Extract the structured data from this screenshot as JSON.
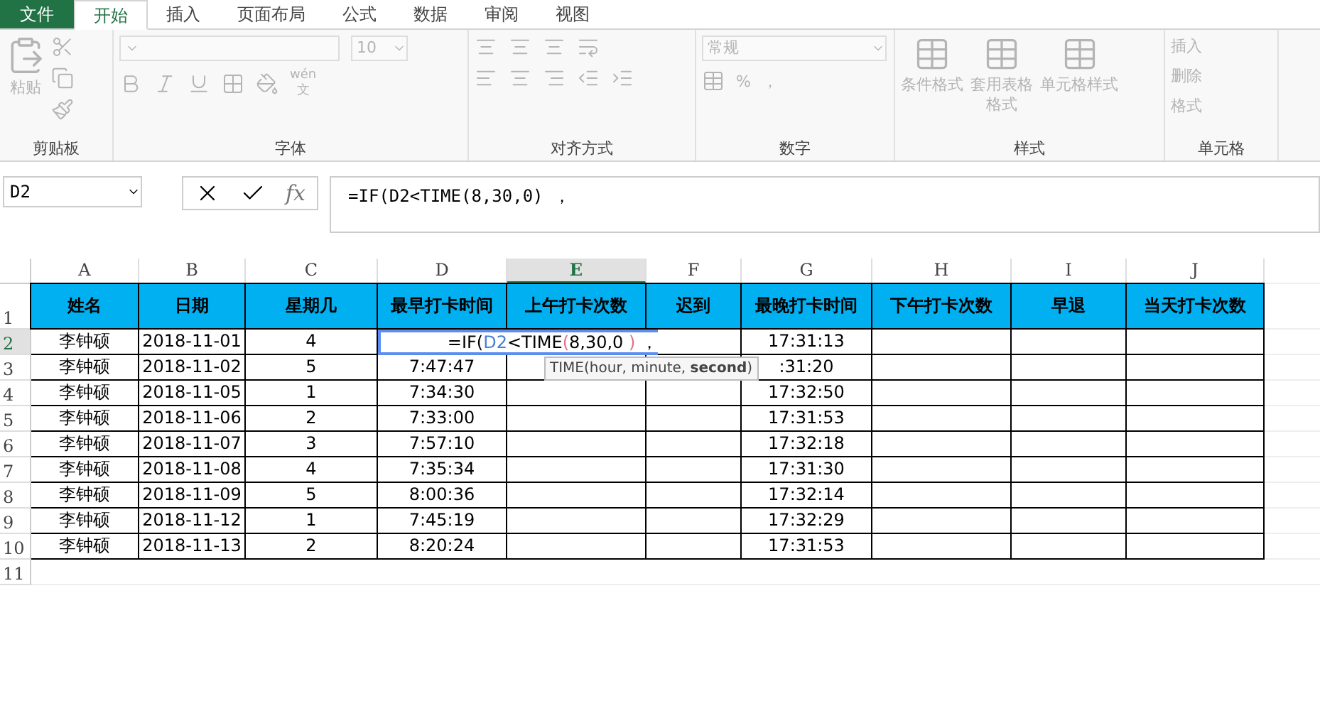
{
  "tabs": [
    {
      "label": "文件",
      "kind": "file",
      "selected": false
    },
    {
      "label": "开始",
      "kind": "tab",
      "selected": true
    },
    {
      "label": "插入",
      "kind": "tab",
      "selected": false
    },
    {
      "label": "页面布局",
      "kind": "tab",
      "selected": false
    },
    {
      "label": "公式",
      "kind": "tab",
      "selected": false
    },
    {
      "label": "数据",
      "kind": "tab",
      "selected": false
    },
    {
      "label": "审阅",
      "kind": "tab",
      "selected": false
    },
    {
      "label": "视图",
      "kind": "tab",
      "selected": false
    }
  ],
  "ribbon": {
    "disabled": true,
    "clipboard": {
      "paste": "粘贴",
      "label": "剪贴板"
    },
    "font": {
      "size": "10",
      "phonetic_top": "wén",
      "phonetic_bottom": "文",
      "label": "字体"
    },
    "alignment": {
      "label": "对齐方式"
    },
    "number": {
      "format": "常规",
      "percent": "%",
      "comma": "，",
      "label": "数字"
    },
    "styles": {
      "items": [
        "条件格式",
        "套用表格格式",
        "单元格样式"
      ],
      "label": "样式"
    },
    "cells": {
      "items": [
        "插入",
        "删除",
        "格式"
      ],
      "label": "单元格"
    }
  },
  "name_box": "D2",
  "function_button": "fx",
  "formula": "=IF(D2<TIME(8,30,0) ，",
  "columns": [
    {
      "label": "A",
      "selected": false
    },
    {
      "label": "B",
      "selected": false
    },
    {
      "label": "C",
      "selected": false
    },
    {
      "label": "D",
      "selected": false
    },
    {
      "label": "E",
      "selected": true
    },
    {
      "label": "F",
      "selected": false
    },
    {
      "label": "G",
      "selected": false
    },
    {
      "label": "H",
      "selected": false
    },
    {
      "label": "I",
      "selected": false
    },
    {
      "label": "J",
      "selected": false
    }
  ],
  "header_row": {
    "number": "1",
    "cells": [
      "姓名",
      "日期",
      "星期几",
      "最早打卡时间",
      "上午打卡次数",
      "迟到",
      "最晚打卡时间",
      "下午打卡次数",
      "早退",
      "当天打卡次数"
    ]
  },
  "rows": [
    {
      "number": "2",
      "selected": true,
      "cells": [
        "李钟硕",
        "2018-11-01",
        "4",
        null,
        null,
        null,
        "17:31:13",
        null,
        null,
        null
      ]
    },
    {
      "number": "3",
      "selected": false,
      "cells": [
        "李钟硕",
        "2018-11-02",
        "5",
        "7:47:47",
        null,
        null,
        ":31:20",
        null,
        null,
        null
      ]
    },
    {
      "number": "4",
      "selected": false,
      "cells": [
        "李钟硕",
        "2018-11-05",
        "1",
        "7:34:30",
        null,
        null,
        "17:32:50",
        null,
        null,
        null
      ]
    },
    {
      "number": "5",
      "selected": false,
      "cells": [
        "李钟硕",
        "2018-11-06",
        "2",
        "7:33:00",
        null,
        null,
        "17:31:53",
        null,
        null,
        null
      ]
    },
    {
      "number": "6",
      "selected": false,
      "cells": [
        "李钟硕",
        "2018-11-07",
        "3",
        "7:57:10",
        null,
        null,
        "17:32:18",
        null,
        null,
        null
      ]
    },
    {
      "number": "7",
      "selected": false,
      "cells": [
        "李钟硕",
        "2018-11-08",
        "4",
        "7:35:34",
        null,
        null,
        "17:31:30",
        null,
        null,
        null
      ]
    },
    {
      "number": "8",
      "selected": false,
      "cells": [
        "李钟硕",
        "2018-11-09",
        "5",
        "8:00:36",
        null,
        null,
        "17:32:14",
        null,
        null,
        null
      ]
    },
    {
      "number": "9",
      "selected": false,
      "cells": [
        "李钟硕",
        "2018-11-12",
        "1",
        "7:45:19",
        null,
        null,
        "17:32:29",
        null,
        null,
        null
      ]
    },
    {
      "number": "10",
      "selected": false,
      "cells": [
        "李钟硕",
        "2018-11-13",
        "2",
        "8:20:24",
        null,
        null,
        "17:31:53",
        null,
        null,
        null
      ]
    }
  ],
  "extra_row": "11",
  "cell_edit": {
    "segments": [
      {
        "text": "=IF(",
        "color": "#000000"
      },
      {
        "text": "D2",
        "color": "#4a7fd8"
      },
      {
        "text": "<TIME",
        "color": "#000000"
      },
      {
        "text": "(",
        "color": "#e0708a"
      },
      {
        "text": "8,30,0",
        "color": "#000000"
      },
      {
        "text": " )",
        "color": "#e0708a"
      },
      {
        "text": " ，",
        "color": "#000000"
      }
    ]
  },
  "tooltip": "TIME(hour, minute, **second**)"
}
